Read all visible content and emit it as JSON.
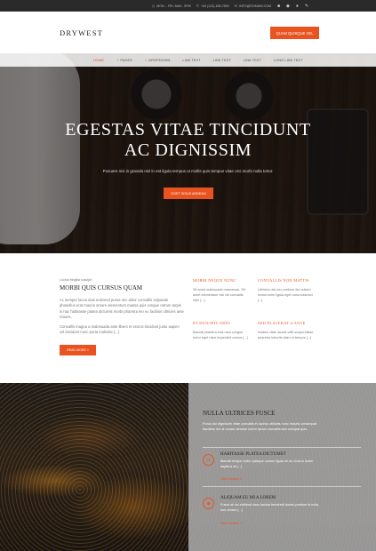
{
  "topbar": {
    "hours": "MON. - FRI. 8AM - 5PM",
    "phone": "+00 (123) 456-7890",
    "email": "INFO@DOMAIN.COM"
  },
  "header": {
    "logo": "DRYWEST",
    "cta": "QUAM QUISQUE VEL"
  },
  "nav": {
    "items": [
      {
        "label": "HOME",
        "active": true
      },
      {
        "label": "PAGES",
        "dropdown": true
      },
      {
        "label": "DROPDOWN",
        "dropdown": true
      },
      {
        "label": "LINK TEXT"
      },
      {
        "label": "LINK TEXT"
      },
      {
        "label": "LINK TEXT"
      },
      {
        "label": "LONG LINK TEXT"
      }
    ]
  },
  "hero": {
    "title_line1": "EGESTAS VITAE TINCIDUNT",
    "title_line2": "AC DIGNISSIM",
    "subtitle": "Posuere nisi in gravida nisl in est ligula tempus ut mollis quis tempus vitae orci morbi nulla tortor.",
    "button": "EGET SISUS AENEAN"
  },
  "intro": {
    "kicker": "Luctus fringilla suscipit",
    "title": "MORBI QUIS CURSUS QUAM",
    "para1": "Ac semper lacus duis euismod purus nec dolor convallis vulputate phasellus erat mauris ornare elementum massa quis congue rutrum turpis in hac habitasse platea dictumst morbi pharetra leo eu facilisis ultricies ante mauris.",
    "para2": "Convallis magna a malesuada ante libero et erat ut tincidunt justo sapien vel tincidunt nunc porta molestie [...]",
    "button": "READ MORE »"
  },
  "features": [
    {
      "title": "MORBI NEQUE NUNC",
      "desc": "Sit amet malesuada maecenas. Sit amet elementum nisi vel convallis nibh [...]"
    },
    {
      "title": "CONVALLIS NON MATTIS",
      "desc": "Ultricies nisi nec pretium dui nullam lectus enim ligula eget urna euismod [...]"
    },
    {
      "title": "ET DUICIPIT ODIO",
      "desc": "Blandit pharetra erat nam congue tortor eget risus imperdiet cursus [...]"
    },
    {
      "title": "SED PLACERAT A ANTE",
      "desc": "Nullam vitae iaculis velit suspendisse pharetra lobortis diam et tempor [...]"
    }
  ],
  "panel": {
    "title": "NULLA ULTRICES FUSCE",
    "desc": "Purus dui dignissim vitae convallis et lacinia ultricies nunc mauris consequat faucibus leo at ornare aenean lorem ipsum convallis sed volutpat quis.",
    "services": [
      {
        "title": "HABITASSE PLATEA DICTUMST",
        "desc": "Blandit tempor tortor quisque cursus ligula mi eu viverra lorem dapibus at [...]",
        "link": "View Details »"
      },
      {
        "title": "ALIQUAM EU MI A LOREM",
        "desc": "Fusce at dui eleifend risus lacinia hendrerit donec pretium id nulla non ornare [...]",
        "link": "View Details »"
      }
    ]
  },
  "colors": {
    "accent": "#e8531f",
    "dark": "#2a2a2a"
  }
}
